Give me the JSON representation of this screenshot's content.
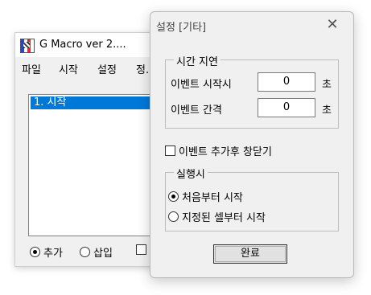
{
  "main_window": {
    "title": "G Macro  ver 2....",
    "menu": [
      "파일",
      "시작",
      "설정",
      "정."
    ],
    "list_items": [
      "1. 시작"
    ],
    "bottom": {
      "radio_add": "추가",
      "radio_insert": "삽입"
    }
  },
  "dialog": {
    "title": "설정 [기타]",
    "close_label": "✕",
    "time_delay": {
      "label": "시간 지연",
      "event_start_label": "이벤트 시작시",
      "event_start_value": "0",
      "event_interval_label": "이벤트 간격",
      "event_interval_value": "0",
      "unit": "초"
    },
    "close_after_add": {
      "label": "이벤트 추가후 창닫기",
      "checked": false
    },
    "run_options": {
      "label": "실행시",
      "from_start": "처음부터 시작",
      "from_selected": "지정된 셀부터 시작",
      "selected": "from_start"
    },
    "ok_label": "완료"
  }
}
